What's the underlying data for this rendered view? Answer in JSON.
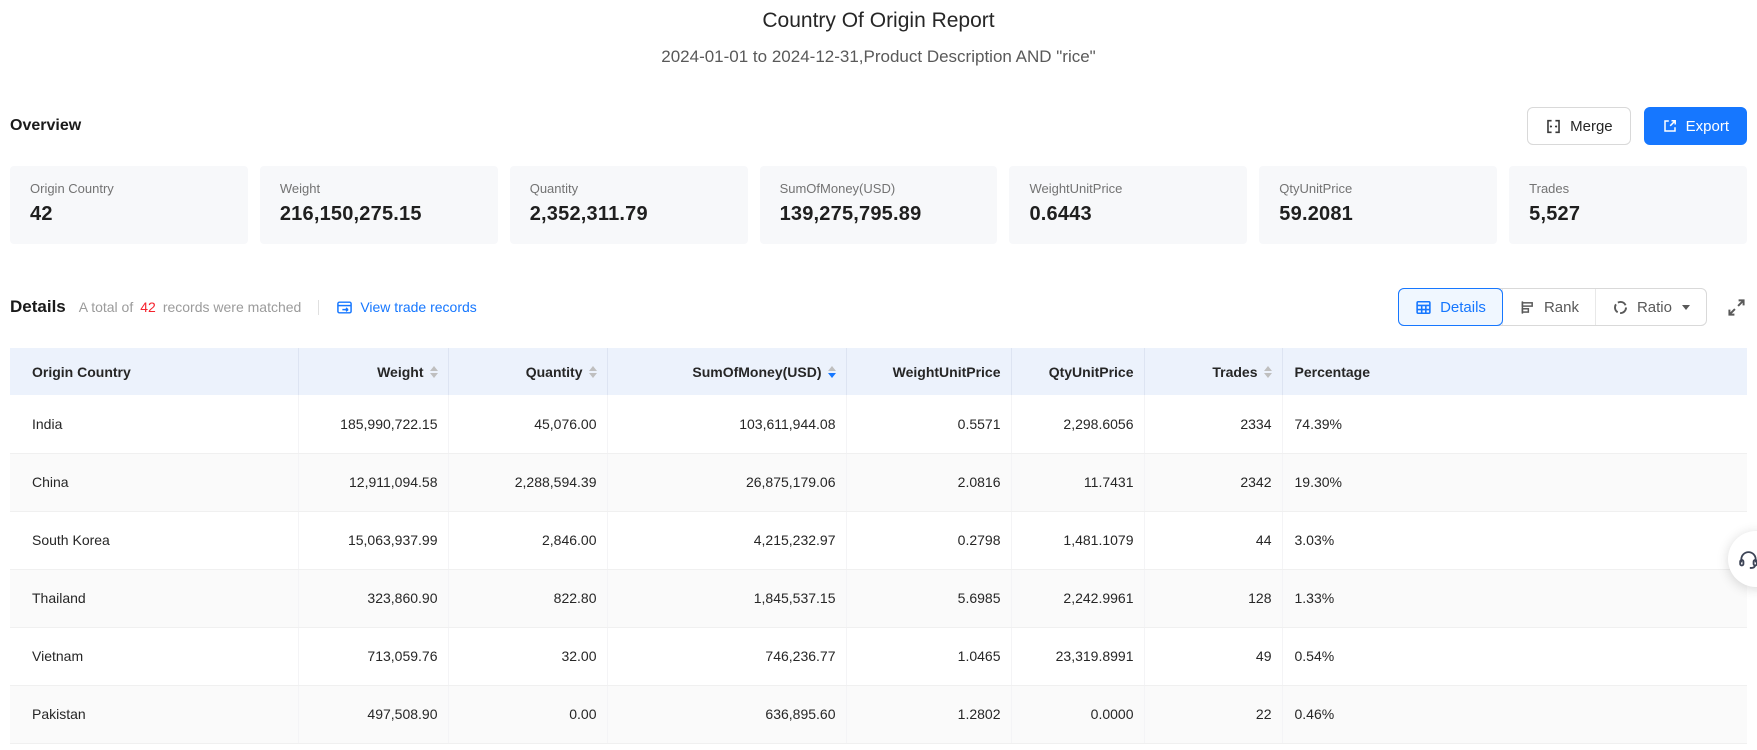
{
  "report": {
    "title": "Country Of Origin Report",
    "subtitle": "2024-01-01 to 2024-12-31,Product Description AND \"rice\""
  },
  "overview": {
    "heading": "Overview",
    "buttons": {
      "merge": "Merge",
      "export": "Export"
    },
    "cards": [
      {
        "label": "Origin Country",
        "value": "42"
      },
      {
        "label": "Weight",
        "value": "216,150,275.15"
      },
      {
        "label": "Quantity",
        "value": "2,352,311.79"
      },
      {
        "label": "SumOfMoney(USD)",
        "value": "139,275,795.89"
      },
      {
        "label": "WeightUnitPrice",
        "value": "0.6443"
      },
      {
        "label": "QtyUnitPrice",
        "value": "59.2081"
      },
      {
        "label": "Trades",
        "value": "5,527"
      }
    ]
  },
  "details": {
    "heading": "Details",
    "matched_prefix": "A total of",
    "matched_count": "42",
    "matched_suffix": "records were matched",
    "view_link": "View trade records",
    "tabs": {
      "details": "Details",
      "rank": "Rank",
      "ratio": "Ratio"
    }
  },
  "table": {
    "columns": [
      {
        "label": "Origin Country",
        "sortable": false
      },
      {
        "label": "Weight",
        "sortable": true
      },
      {
        "label": "Quantity",
        "sortable": true
      },
      {
        "label": "SumOfMoney(USD)",
        "sortable": true,
        "sort": "desc"
      },
      {
        "label": "WeightUnitPrice",
        "sortable": false
      },
      {
        "label": "QtyUnitPrice",
        "sortable": false
      },
      {
        "label": "Trades",
        "sortable": true
      },
      {
        "label": "Percentage",
        "sortable": false
      }
    ],
    "rows": [
      [
        "India",
        "185,990,722.15",
        "45,076.00",
        "103,611,944.08",
        "0.5571",
        "2,298.6056",
        "2334",
        "74.39%"
      ],
      [
        "China",
        "12,911,094.58",
        "2,288,594.39",
        "26,875,179.06",
        "2.0816",
        "11.7431",
        "2342",
        "19.30%"
      ],
      [
        "South Korea",
        "15,063,937.99",
        "2,846.00",
        "4,215,232.97",
        "0.2798",
        "1,481.1079",
        "44",
        "3.03%"
      ],
      [
        "Thailand",
        "323,860.90",
        "822.80",
        "1,845,537.15",
        "5.6985",
        "2,242.9961",
        "128",
        "1.33%"
      ],
      [
        "Vietnam",
        "713,059.76",
        "32.00",
        "746,236.77",
        "1.0465",
        "23,319.8991",
        "49",
        "0.54%"
      ],
      [
        "Pakistan",
        "497,508.90",
        "0.00",
        "636,895.60",
        "1.2802",
        "0.0000",
        "22",
        "0.46%"
      ]
    ]
  },
  "colors": {
    "accent_blue": "#1677FF",
    "count_red": "#F5222D",
    "table_header_bg": "#ECF2FC"
  }
}
